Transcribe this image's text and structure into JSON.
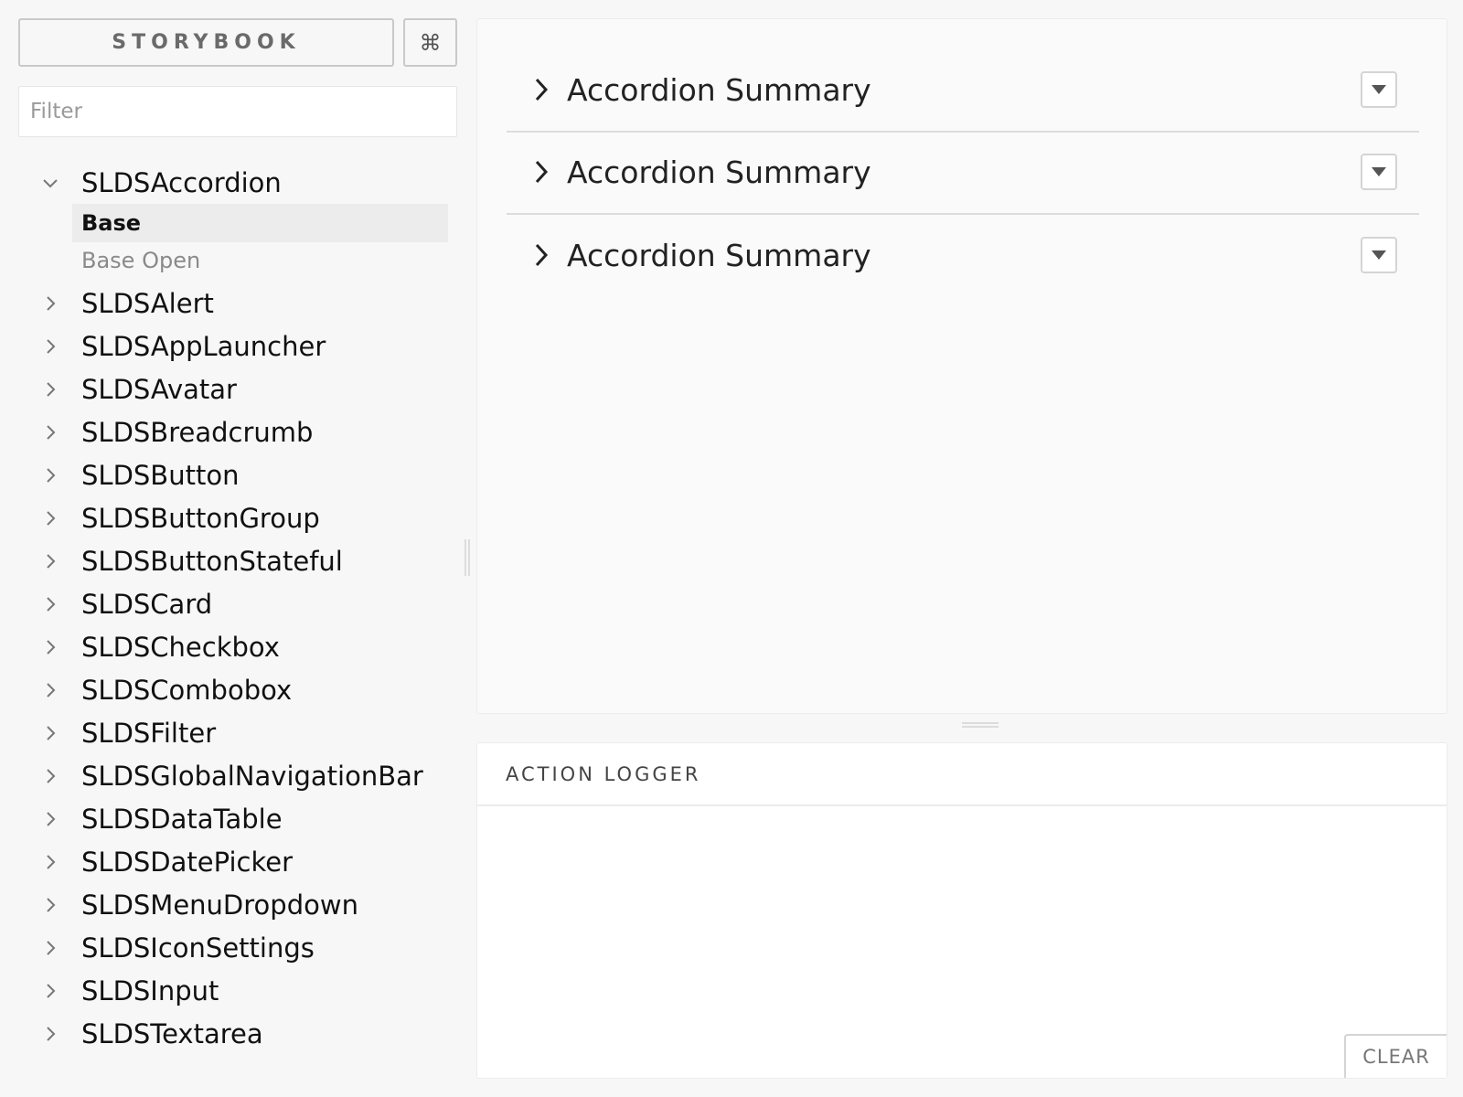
{
  "sidebar": {
    "brand_label": "STORYBOOK",
    "shortcut_symbol": "⌘",
    "filter_placeholder": "Filter",
    "filter_value": "",
    "expanded_component": {
      "label": "SLDSAccordion",
      "stories": [
        {
          "label": "Base",
          "active": true
        },
        {
          "label": "Base Open",
          "active": false
        }
      ]
    },
    "components": [
      "SLDSAlert",
      "SLDSAppLauncher",
      "SLDSAvatar",
      "SLDSBreadcrumb",
      "SLDSButton",
      "SLDSButtonGroup",
      "SLDSButtonStateful",
      "SLDSCard",
      "SLDSCheckbox",
      "SLDSCombobox",
      "SLDSFilter",
      "SLDSGlobalNavigationBar",
      "SLDSDataTable",
      "SLDSDatePicker",
      "SLDSMenuDropdown",
      "SLDSIconSettings",
      "SLDSInput",
      "SLDSTextarea"
    ]
  },
  "preview": {
    "accordion_items": [
      {
        "title": "Accordion Summary"
      },
      {
        "title": "Accordion Summary"
      },
      {
        "title": "Accordion Summary"
      }
    ]
  },
  "logger": {
    "title": "ACTION LOGGER",
    "clear_label": "CLEAR"
  }
}
